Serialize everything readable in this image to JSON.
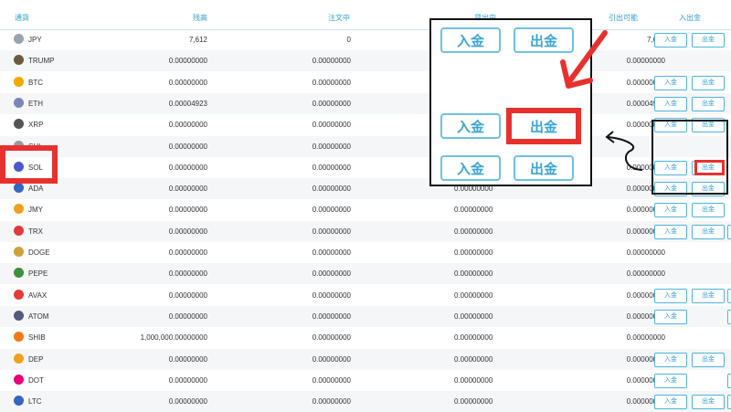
{
  "header": {
    "col_currency": "通貨",
    "col_balance": "残高",
    "col_order": "注文中",
    "col_lending": "貸出中",
    "col_withdrawable": "引出可能",
    "col_actions": "入出金"
  },
  "labels": {
    "deposit": "入金",
    "withdraw": "出金"
  },
  "rows": [
    {
      "name": "JPY",
      "balance": "7,612",
      "order": "0",
      "lending": "",
      "withdrawable": "7,612",
      "dep": true,
      "wd": true,
      "edge": false,
      "color": "#9aa3ad"
    },
    {
      "name": "TRUMP",
      "balance": "0.00000000",
      "order": "0.00000000",
      "lending": "",
      "withdrawable": "0.00000000",
      "dep": false,
      "wd": false,
      "edge": false,
      "color": "#6b5a3c"
    },
    {
      "name": "BTC",
      "balance": "0.00000000",
      "order": "0.00000000",
      "lending": "",
      "withdrawable": "0.00000000",
      "dep": true,
      "wd": true,
      "edge": false,
      "color": "#f2a900"
    },
    {
      "name": "ETH",
      "balance": "0.00004923",
      "order": "0.00000000",
      "lending": "",
      "withdrawable": "0.00004923",
      "dep": true,
      "wd": true,
      "edge": false,
      "color": "#7b86b8"
    },
    {
      "name": "XRP",
      "balance": "0.00000000",
      "order": "0.00000000",
      "lending": "",
      "withdrawable": "0.00000000",
      "dep": true,
      "wd": true,
      "edge": false,
      "color": "#555555"
    },
    {
      "name": "SHI",
      "balance": "0.00000000",
      "order": "0.00000000",
      "lending": "",
      "withdrawable": "",
      "dep": false,
      "wd": false,
      "edge": false,
      "color": "#999999"
    },
    {
      "name": "SOL",
      "balance": "0.00000000",
      "order": "0.00000000",
      "lending": "",
      "withdrawable": "0.00000000",
      "dep": true,
      "wd": true,
      "edge": false,
      "color": "#4a5ac8"
    },
    {
      "name": "ADA",
      "balance": "0.00000000",
      "order": "0.00000000",
      "lending": "0.00000000",
      "withdrawable": "0.00000000",
      "dep": true,
      "wd": true,
      "edge": false,
      "color": "#3466c2"
    },
    {
      "name": "JMY",
      "balance": "0.00000000",
      "order": "0.00000000",
      "lending": "0.00000000",
      "withdrawable": "0.00000000",
      "dep": true,
      "wd": true,
      "edge": false,
      "color": "#f0a020"
    },
    {
      "name": "TRX",
      "balance": "0.00000000",
      "order": "0.00000000",
      "lending": "0.00000000",
      "withdrawable": "0.00000000",
      "dep": true,
      "wd": true,
      "edge": true,
      "color": "#e23b3b"
    },
    {
      "name": "DOGE",
      "balance": "0.00000000",
      "order": "0.00000000",
      "lending": "0.00000000",
      "withdrawable": "0.00000000",
      "dep": false,
      "wd": false,
      "edge": false,
      "color": "#c9a23b"
    },
    {
      "name": "PEPE",
      "balance": "0.00000000",
      "order": "0.00000000",
      "lending": "0.00000000",
      "withdrawable": "0.00000000",
      "dep": false,
      "wd": false,
      "edge": false,
      "color": "#3f8f3a"
    },
    {
      "name": "AVAX",
      "balance": "0.00000000",
      "order": "0.00000000",
      "lending": "0.00000000",
      "withdrawable": "0.00000000",
      "dep": true,
      "wd": true,
      "edge": true,
      "color": "#e23b3b"
    },
    {
      "name": "ATOM",
      "balance": "0.00000000",
      "order": "0.00000000",
      "lending": "0.00000000",
      "withdrawable": "0.00000000",
      "dep": true,
      "wd": false,
      "edge": true,
      "color": "#555b7a"
    },
    {
      "name": "SHIB",
      "balance": "1,000,000.00000000",
      "order": "0.00000000",
      "lending": "0.00000000",
      "withdrawable": "0.00000000",
      "dep": false,
      "wd": false,
      "edge": false,
      "color": "#f07a1a"
    },
    {
      "name": "DEP",
      "balance": "0.00000000",
      "order": "0.00000000",
      "lending": "0.00000000",
      "withdrawable": "0.00000000",
      "dep": true,
      "wd": true,
      "edge": false,
      "color": "#f0a020"
    },
    {
      "name": "DOT",
      "balance": "0.00000000",
      "order": "0.00000000",
      "lending": "0.00000000",
      "withdrawable": "0.00000000",
      "dep": true,
      "wd": false,
      "edge": true,
      "color": "#e6007a"
    },
    {
      "name": "LTC",
      "balance": "0.00000000",
      "order": "0.00000000",
      "lending": "0.00000000",
      "withdrawable": "0.00000000",
      "dep": true,
      "wd": true,
      "edge": true,
      "color": "#3466c2"
    }
  ],
  "annotation": {
    "deposit_label": "入金",
    "withdraw_label": "出金",
    "small_withdraw_label": "出金"
  }
}
